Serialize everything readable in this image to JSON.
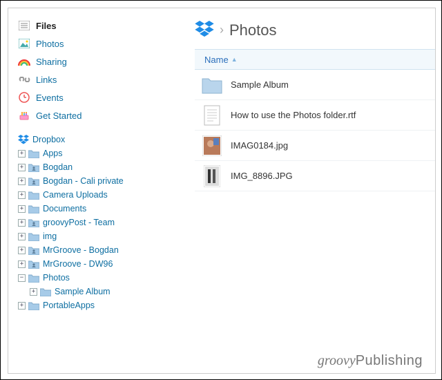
{
  "nav": {
    "files": "Files",
    "photos": "Photos",
    "sharing": "Sharing",
    "links": "Links",
    "events": "Events",
    "get_started": "Get Started"
  },
  "tree": {
    "root": "Dropbox",
    "items": [
      {
        "label": "Apps",
        "shared": false
      },
      {
        "label": "Bogdan",
        "shared": true
      },
      {
        "label": "Bogdan - Cali private",
        "shared": true
      },
      {
        "label": "Camera Uploads",
        "shared": false
      },
      {
        "label": "Documents",
        "shared": false
      },
      {
        "label": "groovyPost - Team",
        "shared": true
      },
      {
        "label": "img",
        "shared": false
      },
      {
        "label": "MrGroove - Bogdan",
        "shared": true
      },
      {
        "label": "MrGroove - DW96",
        "shared": true
      }
    ],
    "photos": "Photos",
    "sample_album": "Sample Album",
    "portable": "PortableApps"
  },
  "breadcrumb": {
    "title": "Photos"
  },
  "table": {
    "col_name": "Name"
  },
  "files": [
    {
      "name": "Sample Album",
      "kind": "folder"
    },
    {
      "name": "How to use the Photos folder.rtf",
      "kind": "doc"
    },
    {
      "name": "IMAG0184.jpg",
      "kind": "image1"
    },
    {
      "name": "IMG_8896.JPG",
      "kind": "image2"
    }
  ],
  "watermark": {
    "a": "groovy",
    "b": "Publishing"
  }
}
